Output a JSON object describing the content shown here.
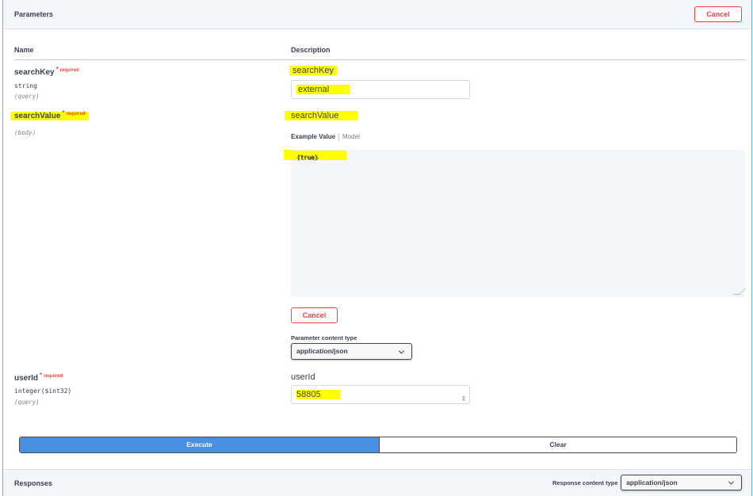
{
  "header": {
    "title": "Parameters",
    "cancel_label": "Cancel"
  },
  "columns": {
    "name": "Name",
    "description": "Description"
  },
  "params": [
    {
      "name": "searchKey",
      "required_star": "*",
      "required_label": "required",
      "type": "string",
      "location": "(query)",
      "desc_label": "searchKey",
      "value": "external"
    },
    {
      "name": "searchValue",
      "required_star": "*",
      "required_label": "required",
      "location": "(body)",
      "desc_label": "searchValue",
      "tab_example": "Example Value",
      "tab_model": "Model",
      "body_value": "{true}",
      "cancel_label": "Cancel",
      "content_type_label": "Parameter content type",
      "content_type_value": "application/json"
    },
    {
      "name": "userId",
      "required_star": "*",
      "required_label": "required",
      "type": "integer($int32)",
      "location": "(query)",
      "desc_label": "userId",
      "value": "58805"
    }
  ],
  "actions": {
    "execute_label": "Execute",
    "clear_label": "Clear"
  },
  "responses": {
    "title": "Responses",
    "content_type_label": "Response content type",
    "content_type_value": "application/json"
  },
  "colors": {
    "accent": "#4990e2",
    "danger": "#f93e3e",
    "highlight": "#ffff00",
    "border": "#61affe"
  }
}
